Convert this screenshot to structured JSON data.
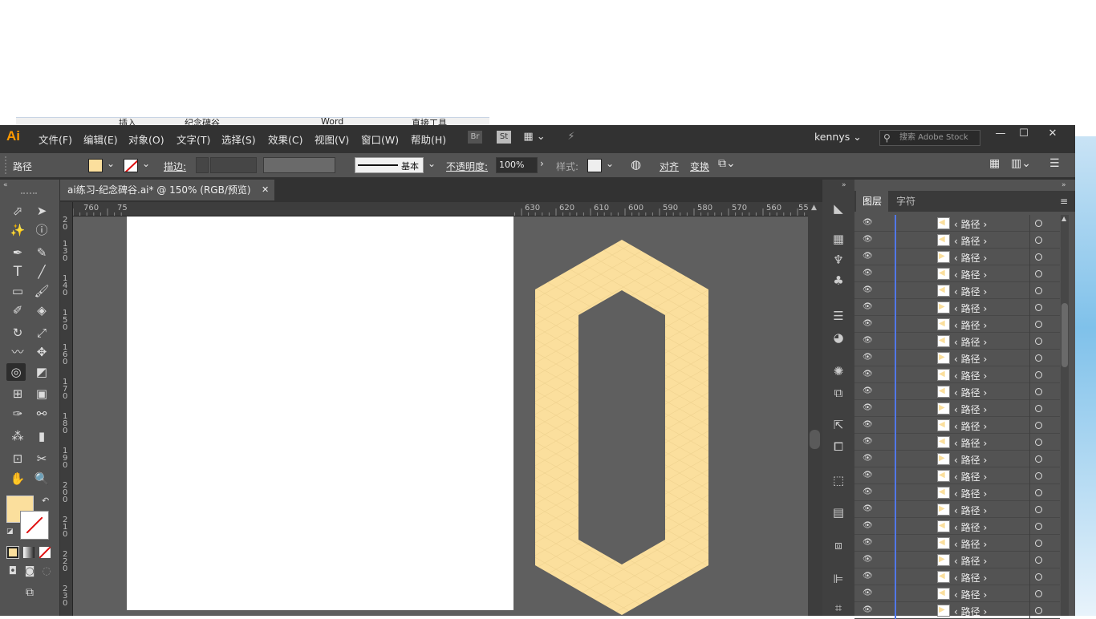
{
  "behind_window": {
    "text": [
      "插入",
      "纪念碑谷",
      "Word",
      "直接工具"
    ]
  },
  "app": {
    "logo": "Ai",
    "menu": [
      "文件(F)",
      "编辑(E)",
      "对象(O)",
      "文字(T)",
      "选择(S)",
      "效果(C)",
      "视图(V)",
      "窗口(W)",
      "帮助(H)"
    ],
    "bridge_label": "Br",
    "stock_label": "St",
    "user": "kennys",
    "search_placeholder": "搜索 Adobe Stock",
    "fill_color": "#fbdf9d"
  },
  "control": {
    "selection_label": "路径",
    "stroke_label": "描边:",
    "brush_label": "基本",
    "opacity_label": "不透明度:",
    "opacity_value": "100%",
    "style_label": "样式:",
    "align_label": "对齐",
    "transform_label": "变换"
  },
  "doc": {
    "tab_title": "ai练习-纪念碑谷.ai* @ 150% (RGB/预览)"
  },
  "ruler": {
    "h_ticks": [
      "760",
      "75",
      "630",
      "620",
      "610",
      "600",
      "590",
      "580",
      "570",
      "560",
      "55"
    ],
    "v_ticks": [
      "20",
      "130",
      "140",
      "150",
      "160",
      "170",
      "180",
      "190",
      "200",
      "210",
      "220",
      "230"
    ]
  },
  "panel": {
    "tabs": [
      "图层",
      "字符"
    ],
    "layer_name": "路径",
    "layer_count": 24
  },
  "icons": [
    "selection-icon",
    "direct-select-icon",
    "magic-wand-icon",
    "lasso-icon",
    "pen-icon",
    "curvature-icon",
    "type-icon",
    "line-icon",
    "rectangle-icon",
    "paintbrush-icon",
    "shaper-icon",
    "eraser-icon",
    "rotate-icon",
    "scale-icon",
    "warp-icon",
    "pin-icon",
    "shape-builder-icon",
    "perspective-icon",
    "mesh-icon",
    "gradient-icon",
    "eyedropper-icon",
    "blend-icon",
    "symbol-sprayer-icon",
    "graph-icon",
    "artboard-icon",
    "slice-icon",
    "hand-icon",
    "zoom-icon"
  ]
}
